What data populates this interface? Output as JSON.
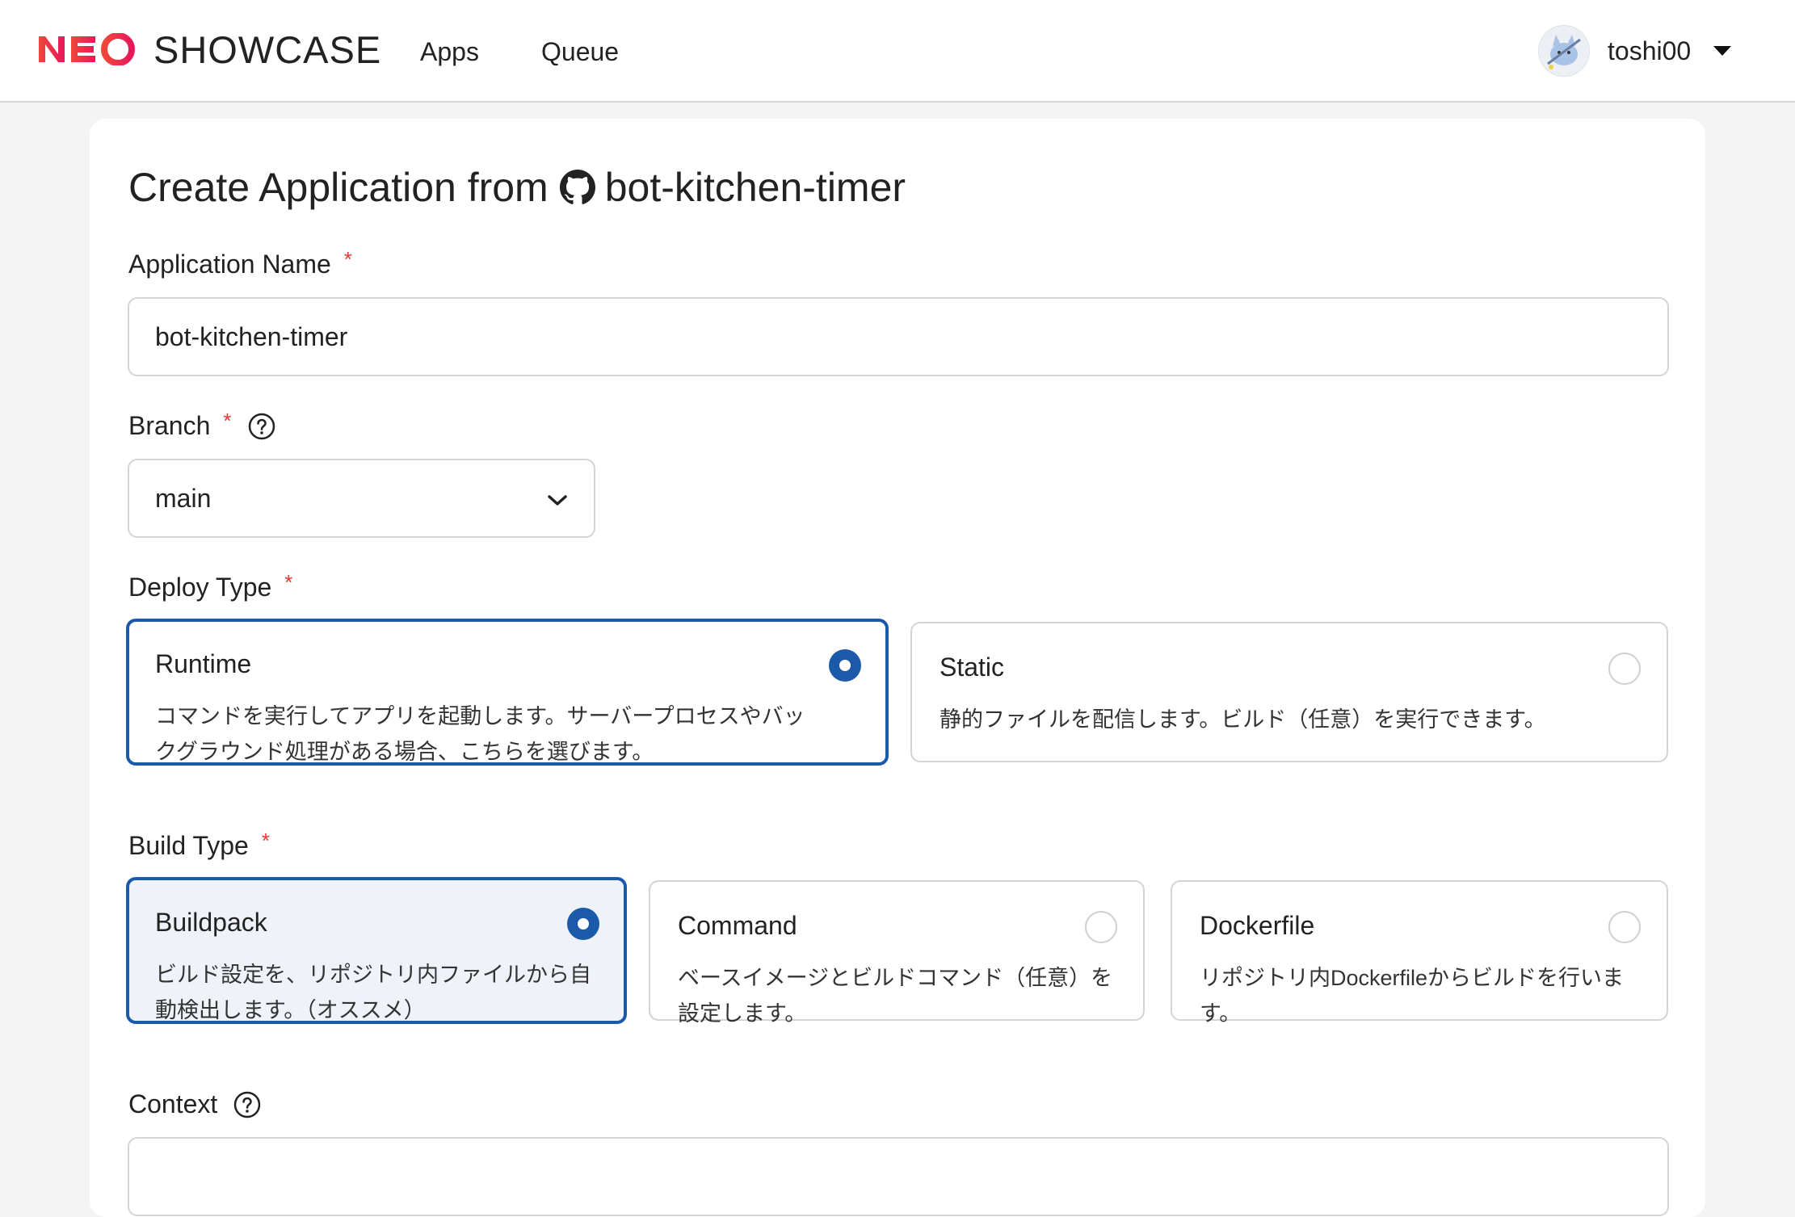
{
  "header": {
    "logo_neo": "NEO",
    "logo_showcase": "SHOWCASE",
    "nav": [
      {
        "label": "Apps"
      },
      {
        "label": "Queue"
      }
    ],
    "user": {
      "name": "toshi00"
    }
  },
  "page": {
    "title_prefix": "Create Application from",
    "repo_name": "bot-kitchen-timer"
  },
  "form": {
    "app_name": {
      "label": "Application Name",
      "required_mark": "*",
      "value": "bot-kitchen-timer"
    },
    "branch": {
      "label": "Branch",
      "required_mark": "*",
      "value": "main"
    },
    "deploy_type": {
      "label": "Deploy Type",
      "required_mark": "*",
      "options": [
        {
          "title": "Runtime",
          "desc": "コマンドを実行してアプリを起動します。サーバープロセスやバックグラウンド処理がある場合、こちらを選びます。",
          "selected": true
        },
        {
          "title": "Static",
          "desc": "静的ファイルを配信します。ビルド（任意）を実行できます。",
          "selected": false
        }
      ]
    },
    "build_type": {
      "label": "Build Type",
      "required_mark": "*",
      "options": [
        {
          "title": "Buildpack",
          "desc": "ビルド設定を、リポジトリ内ファイルから自動検出します。（オススメ）",
          "selected": true
        },
        {
          "title": "Command",
          "desc": "ベースイメージとビルドコマンド（任意）を設定します。",
          "selected": false
        },
        {
          "title": "Dockerfile",
          "desc": "リポジトリ内Dockerfileからビルドを行います。",
          "selected": false
        }
      ]
    },
    "context": {
      "label": "Context",
      "value": ""
    }
  },
  "colors": {
    "accent": "#1b5aa8",
    "brand_red": "#e8233f",
    "required": "#e53935"
  }
}
